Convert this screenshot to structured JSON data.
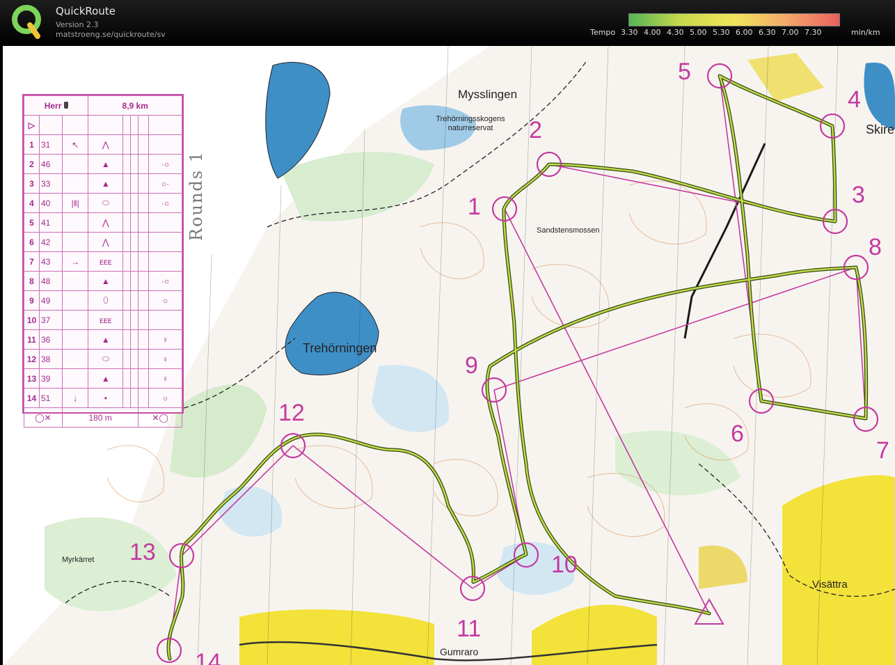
{
  "header": {
    "app_name": "QuickRoute",
    "version": "Version 2.3",
    "url": "matstroeng.se/quickroute/sv",
    "logo_letter": "Q"
  },
  "legend": {
    "title": "Tempo",
    "ticks": [
      "3.30",
      "4.00",
      "4.30",
      "5.00",
      "5.30",
      "6.00",
      "6.30",
      "7.00",
      "7.30"
    ],
    "unit": "min/km",
    "colors": [
      "#55b555",
      "#c9d94b",
      "#f0e65a",
      "#f3a86a",
      "#ea5f5f"
    ]
  },
  "control_card": {
    "class": "Herr",
    "distance": "8,9 km",
    "rows": [
      {
        "num": "1",
        "code": "31",
        "dir": "↖",
        "feature": "⋀",
        "desc": ""
      },
      {
        "num": "2",
        "code": "46",
        "dir": "",
        "feature": "▲",
        "desc": "·○"
      },
      {
        "num": "3",
        "code": "33",
        "dir": "",
        "feature": "▲",
        "desc": "○·"
      },
      {
        "num": "4",
        "code": "40",
        "dir": "|‖|",
        "feature": "⬭",
        "desc": "·○"
      },
      {
        "num": "5",
        "code": "41",
        "dir": "",
        "feature": "⋀",
        "desc": ""
      },
      {
        "num": "6",
        "code": "42",
        "dir": "",
        "feature": "⋀",
        "desc": ""
      },
      {
        "num": "7",
        "code": "43",
        "dir": "→",
        "feature": "ᴇᴇᴇ",
        "desc": ""
      },
      {
        "num": "8",
        "code": "48",
        "dir": "",
        "feature": "▲",
        "desc": "·○"
      },
      {
        "num": "9",
        "code": "49",
        "dir": "",
        "feature": "⬯",
        "desc": "○"
      },
      {
        "num": "10",
        "code": "37",
        "dir": "",
        "feature": "ᴇᴇᴇ",
        "desc": ""
      },
      {
        "num": "11",
        "code": "36",
        "dir": "",
        "feature": "▲",
        "desc": "♀"
      },
      {
        "num": "12",
        "code": "38",
        "dir": "",
        "feature": "⬭",
        "desc": "♀"
      },
      {
        "num": "13",
        "code": "39",
        "dir": "",
        "feature": "▲",
        "desc": "♀"
      },
      {
        "num": "14",
        "code": "51",
        "dir": "↓",
        "feature": "•",
        "desc": "○"
      }
    ],
    "finish_distance": "180 m"
  },
  "handwriting": "Rounds 1",
  "place_names": {
    "mysslingen": "Mysslingen",
    "reserve": "Trehörningsskogens naturreservat",
    "sandstensmossen": "Sandstensmossen",
    "trehorningen": "Trehörningen",
    "skire": "Skire",
    "myrkarret": "Myrkärret",
    "visattra": "Visättra",
    "gumraro": "Gumraro"
  },
  "controls": [
    "1",
    "2",
    "3",
    "4",
    "5",
    "6",
    "7",
    "8",
    "9",
    "10",
    "11",
    "12",
    "13",
    "14"
  ],
  "colors": {
    "course": "#c43aa0",
    "route_dark": "#3a5a10"
  }
}
